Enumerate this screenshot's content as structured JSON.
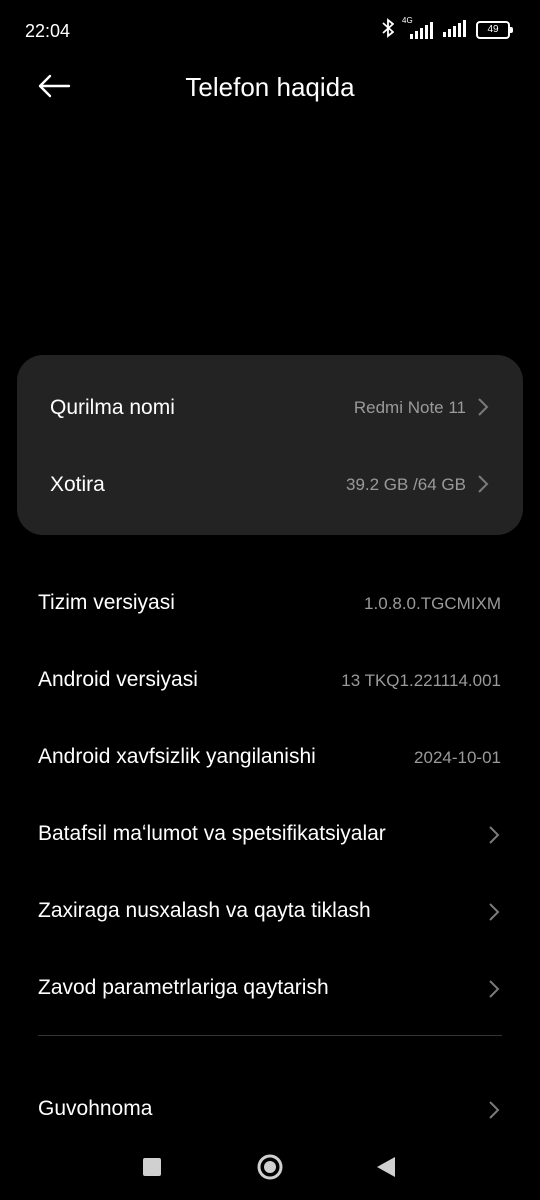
{
  "status_bar": {
    "time": "22:04",
    "network": "4G",
    "battery": "49",
    "icons": [
      "bluetooth-icon",
      "signal-4g-icon",
      "signal-icon",
      "battery-icon"
    ]
  },
  "header": {
    "back_icon": "arrow-left-icon",
    "title": "Telefon haqida"
  },
  "card": {
    "items": [
      {
        "label": "Qurilma nomi",
        "value": "Redmi Note 11"
      },
      {
        "label": "Xotira",
        "value": "39.2 GB /64 GB"
      }
    ]
  },
  "info": {
    "items": [
      {
        "label": "Tizim versiyasi",
        "value": "1.0.8.0.TGCMIXM"
      },
      {
        "label": "Android versiyasi",
        "value": "13 TKQ1.221114.001"
      },
      {
        "label": "Android xavfsizlik yangilanishi",
        "value": "2024-10-01"
      }
    ]
  },
  "links": {
    "items": [
      {
        "label": "Batafsil maʻlumot va spetsifikatsiyalar"
      },
      {
        "label": "Zaxiraga nusxalash va qayta tiklash"
      },
      {
        "label": "Zavod parametrlariga qaytarish"
      }
    ]
  },
  "bottom": {
    "label": "Guvohnoma"
  },
  "nav_bar": {
    "icons": [
      "recents-square-icon",
      "home-circle-icon",
      "back-triangle-icon"
    ]
  },
  "colors": {
    "background": "#000000",
    "card": "#232323",
    "secondary_text": "#9a9a9a",
    "chevron": "#7a7a7a"
  }
}
